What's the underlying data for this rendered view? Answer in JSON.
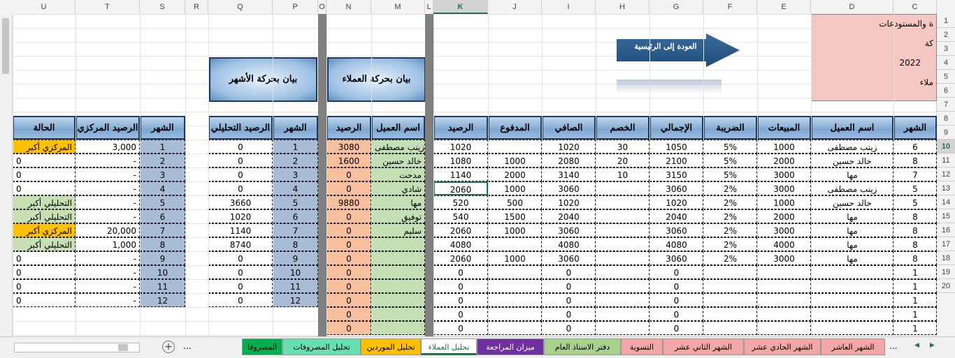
{
  "columns": [
    {
      "letter": "U",
      "l": 18,
      "w": 90
    },
    {
      "letter": "T",
      "l": 108,
      "w": 92
    },
    {
      "letter": "S",
      "l": 200,
      "w": 65
    },
    {
      "letter": "R",
      "l": 265,
      "w": 33
    },
    {
      "letter": "Q",
      "l": 298,
      "w": 92
    },
    {
      "letter": "P",
      "l": 390,
      "w": 65
    },
    {
      "letter": "O",
      "l": 455,
      "w": 12
    },
    {
      "letter": "N",
      "l": 467,
      "w": 64
    },
    {
      "letter": "M",
      "l": 531,
      "w": 77
    },
    {
      "letter": "L",
      "l": 608,
      "w": 12
    },
    {
      "letter": "K",
      "l": 620,
      "w": 78
    },
    {
      "letter": "J",
      "l": 698,
      "w": 77
    },
    {
      "letter": "I",
      "l": 775,
      "w": 77
    },
    {
      "letter": "H",
      "l": 852,
      "w": 77
    },
    {
      "letter": "G",
      "l": 929,
      "w": 77
    },
    {
      "letter": "F",
      "l": 1006,
      "w": 77
    },
    {
      "letter": "E",
      "l": 1083,
      "w": 77
    },
    {
      "letter": "D",
      "l": 1160,
      "w": 118
    },
    {
      "letter": "C",
      "l": 1278,
      "w": 62
    }
  ],
  "selected_column": "K",
  "rows": [
    "1",
    "2",
    "3",
    "4",
    "5",
    "6",
    "7",
    "8",
    "9",
    "10",
    "11",
    "12",
    "13",
    "14",
    "15",
    "16",
    "17",
    "18",
    "19",
    "20"
  ],
  "selected_row": "10",
  "info_box": {
    "line1": "ة والمستودعات",
    "line2": "كة",
    "line3": "2022",
    "line4": "ملاء"
  },
  "back_button": {
    "label": "العودة إلى الرئيسية"
  },
  "title_clients": "بيان بحركة العملاء",
  "title_months": "بيان بحركة الأشهر",
  "main_headers": [
    "الشهر",
    "اسم العميل",
    "المبيعات",
    "الضريبة",
    "الإجمالي",
    "الخصم",
    "الصافي",
    "المدفوع",
    "الرصيد"
  ],
  "main_rows": [
    [
      "6",
      "زينب مصطفى",
      "1000",
      "5%",
      "1050",
      "30",
      "1020",
      "",
      "1020"
    ],
    [
      "8",
      "خالد حسين",
      "2000",
      "5%",
      "2100",
      "20",
      "2080",
      "1000",
      "1080"
    ],
    [
      "7",
      "مها",
      "3000",
      "5%",
      "3150",
      "10",
      "3140",
      "2000",
      "1140"
    ],
    [
      "5",
      "زينب مصطفى",
      "3000",
      "2%",
      "3060",
      "",
      "3060",
      "1000",
      "2060"
    ],
    [
      "5",
      "خالد حسين",
      "1000",
      "2%",
      "1020",
      "",
      "1020",
      "500",
      "520"
    ],
    [
      "8",
      "مها",
      "2000",
      "2%",
      "2040",
      "",
      "2040",
      "1500",
      "540"
    ],
    [
      "8",
      "مها",
      "3000",
      "2%",
      "3060",
      "",
      "3060",
      "1000",
      "2060"
    ],
    [
      "8",
      "مها",
      "4000",
      "2%",
      "4080",
      "",
      "4080",
      "",
      "4080"
    ],
    [
      "8",
      "مها",
      "3000",
      "2%",
      "3060",
      "",
      "3060",
      "1000",
      "2060"
    ],
    [
      "1",
      "",
      "",
      "",
      "0",
      "",
      "0",
      "",
      "0"
    ],
    [
      "1",
      "",
      "",
      "",
      "0",
      "",
      "0",
      "",
      "0"
    ],
    [
      "1",
      "",
      "",
      "",
      "0",
      "",
      "0",
      "",
      "0"
    ],
    [
      "1",
      "",
      "",
      "",
      "0",
      "",
      "0",
      "",
      "0"
    ],
    [
      "1",
      "",
      "",
      "",
      "0",
      "",
      "0",
      "",
      "0"
    ]
  ],
  "client_headers": [
    "اسم العميل",
    "الرصيد"
  ],
  "client_rows": [
    [
      "زينب مصطفى",
      "3080"
    ],
    [
      "خالد حسين",
      "1600"
    ],
    [
      "مدحت",
      "0"
    ],
    [
      "شادي",
      "0"
    ],
    [
      "مها",
      "9880"
    ],
    [
      "توفيق",
      "0"
    ],
    [
      "سليم",
      "0"
    ],
    [
      "",
      "0"
    ],
    [
      "",
      "0"
    ],
    [
      "",
      "0"
    ],
    [
      "",
      "0"
    ],
    [
      "",
      "0"
    ],
    [
      "",
      "0"
    ],
    [
      "",
      "0"
    ]
  ],
  "month_headers": [
    "الشهر",
    "الرصيد التحليلي"
  ],
  "month_rows": [
    [
      "1",
      "0"
    ],
    [
      "2",
      "0"
    ],
    [
      "3",
      "0"
    ],
    [
      "4",
      "0"
    ],
    [
      "5",
      "3660"
    ],
    [
      "6",
      "1020"
    ],
    [
      "7",
      "1140"
    ],
    [
      "8",
      "8740"
    ],
    [
      "9",
      "0"
    ],
    [
      "10",
      "0"
    ],
    [
      "11",
      "0"
    ],
    [
      "12",
      "0"
    ]
  ],
  "central_headers": [
    "الشهر",
    "الرصيد المركزي",
    "الحالة"
  ],
  "central_rows": [
    [
      "1",
      "3,000",
      "المركزي أكبر",
      "orange"
    ],
    [
      "2",
      "-",
      "0",
      ""
    ],
    [
      "3",
      "-",
      "0",
      ""
    ],
    [
      "4",
      "-",
      "0",
      ""
    ],
    [
      "5",
      "-",
      "التحليلي أكبر",
      "green"
    ],
    [
      "6",
      "-",
      "التحليلي أكبر",
      "green"
    ],
    [
      "7",
      "20,000",
      "المركزي أكبر",
      "orange"
    ],
    [
      "8",
      "1,000",
      "التحليلي أكبر",
      "green"
    ],
    [
      "9",
      "-",
      "0",
      ""
    ],
    [
      "10",
      "-",
      "0",
      ""
    ],
    [
      "11",
      "-",
      "0",
      ""
    ],
    [
      "12",
      "-",
      "0",
      ""
    ]
  ],
  "colors": {
    "month_cell": "#a9bcd6",
    "client_name": "#c4dfb4",
    "client_balance": "#f7bf9e",
    "orange": "#ffc000",
    "green": "#c6e0b4",
    "info_box": "#f4c7c3"
  },
  "tabs": [
    {
      "label": "الشهر  العاشر",
      "bg": "#f4a6a6"
    },
    {
      "label": "الشهر الحادي عشر",
      "bg": "#f4a6a6"
    },
    {
      "label": "الشهر  الثاني عشر",
      "bg": "#f4a6a6"
    },
    {
      "label": "التسوية",
      "bg": "#f4a6a6"
    },
    {
      "label": "دفتر الاستاذ العام",
      "bg": "#a9d18e"
    },
    {
      "label": "ميزان المراجعة",
      "bg": "#7030a0"
    },
    {
      "label": "تحليل العملاء",
      "bg": "#ffffff"
    },
    {
      "label": "تحليل الموردين",
      "bg": "#ffc000"
    },
    {
      "label": "تحليل المصروفات",
      "bg": "#66e0b0"
    },
    {
      "label": "المصروفا",
      "bg": "#00b050"
    }
  ],
  "tab_more": "...",
  "add_sheet": "+",
  "nav_prev": "◀",
  "nav_next": "▶"
}
